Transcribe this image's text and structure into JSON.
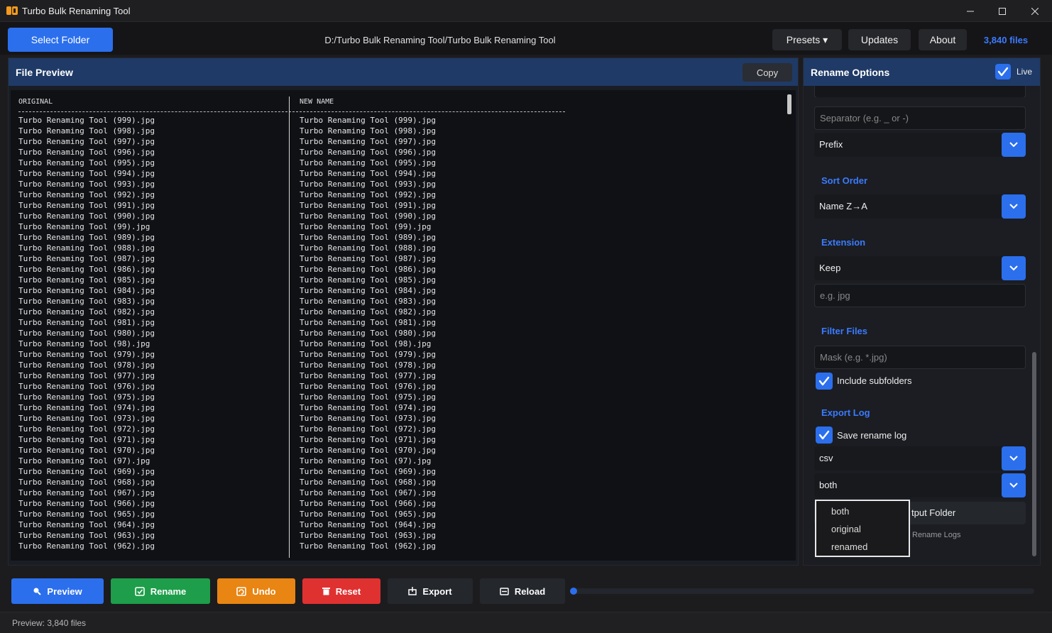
{
  "window": {
    "title": "Turbo Bulk Renaming Tool"
  },
  "toolbar": {
    "select_folder": "Select Folder",
    "path": "D:/Turbo Bulk Renaming Tool/Turbo Bulk Renaming Tool",
    "presets": "Presets ▾",
    "updates": "Updates",
    "about": "About",
    "files_count": "3,840 files"
  },
  "preview": {
    "title": "File Preview",
    "copy": "Copy",
    "col_original": "ORIGINAL",
    "col_new": "NEW NAME",
    "rows": [
      [
        "Turbo Renaming Tool (999).jpg",
        "Turbo Renaming Tool (999).jpg"
      ],
      [
        "Turbo Renaming Tool (998).jpg",
        "Turbo Renaming Tool (998).jpg"
      ],
      [
        "Turbo Renaming Tool (997).jpg",
        "Turbo Renaming Tool (997).jpg"
      ],
      [
        "Turbo Renaming Tool (996).jpg",
        "Turbo Renaming Tool (996).jpg"
      ],
      [
        "Turbo Renaming Tool (995).jpg",
        "Turbo Renaming Tool (995).jpg"
      ],
      [
        "Turbo Renaming Tool (994).jpg",
        "Turbo Renaming Tool (994).jpg"
      ],
      [
        "Turbo Renaming Tool (993).jpg",
        "Turbo Renaming Tool (993).jpg"
      ],
      [
        "Turbo Renaming Tool (992).jpg",
        "Turbo Renaming Tool (992).jpg"
      ],
      [
        "Turbo Renaming Tool (991).jpg",
        "Turbo Renaming Tool (991).jpg"
      ],
      [
        "Turbo Renaming Tool (990).jpg",
        "Turbo Renaming Tool (990).jpg"
      ],
      [
        "Turbo Renaming Tool (99).jpg",
        "Turbo Renaming Tool (99).jpg"
      ],
      [
        "Turbo Renaming Tool (989).jpg",
        "Turbo Renaming Tool (989).jpg"
      ],
      [
        "Turbo Renaming Tool (988).jpg",
        "Turbo Renaming Tool (988).jpg"
      ],
      [
        "Turbo Renaming Tool (987).jpg",
        "Turbo Renaming Tool (987).jpg"
      ],
      [
        "Turbo Renaming Tool (986).jpg",
        "Turbo Renaming Tool (986).jpg"
      ],
      [
        "Turbo Renaming Tool (985).jpg",
        "Turbo Renaming Tool (985).jpg"
      ],
      [
        "Turbo Renaming Tool (984).jpg",
        "Turbo Renaming Tool (984).jpg"
      ],
      [
        "Turbo Renaming Tool (983).jpg",
        "Turbo Renaming Tool (983).jpg"
      ],
      [
        "Turbo Renaming Tool (982).jpg",
        "Turbo Renaming Tool (982).jpg"
      ],
      [
        "Turbo Renaming Tool (981).jpg",
        "Turbo Renaming Tool (981).jpg"
      ],
      [
        "Turbo Renaming Tool (980).jpg",
        "Turbo Renaming Tool (980).jpg"
      ],
      [
        "Turbo Renaming Tool (98).jpg",
        "Turbo Renaming Tool (98).jpg"
      ],
      [
        "Turbo Renaming Tool (979).jpg",
        "Turbo Renaming Tool (979).jpg"
      ],
      [
        "Turbo Renaming Tool (978).jpg",
        "Turbo Renaming Tool (978).jpg"
      ],
      [
        "Turbo Renaming Tool (977).jpg",
        "Turbo Renaming Tool (977).jpg"
      ],
      [
        "Turbo Renaming Tool (976).jpg",
        "Turbo Renaming Tool (976).jpg"
      ],
      [
        "Turbo Renaming Tool (975).jpg",
        "Turbo Renaming Tool (975).jpg"
      ],
      [
        "Turbo Renaming Tool (974).jpg",
        "Turbo Renaming Tool (974).jpg"
      ],
      [
        "Turbo Renaming Tool (973).jpg",
        "Turbo Renaming Tool (973).jpg"
      ],
      [
        "Turbo Renaming Tool (972).jpg",
        "Turbo Renaming Tool (972).jpg"
      ],
      [
        "Turbo Renaming Tool (971).jpg",
        "Turbo Renaming Tool (971).jpg"
      ],
      [
        "Turbo Renaming Tool (970).jpg",
        "Turbo Renaming Tool (970).jpg"
      ],
      [
        "Turbo Renaming Tool (97).jpg",
        "Turbo Renaming Tool (97).jpg"
      ],
      [
        "Turbo Renaming Tool (969).jpg",
        "Turbo Renaming Tool (969).jpg"
      ],
      [
        "Turbo Renaming Tool (968).jpg",
        "Turbo Renaming Tool (968).jpg"
      ],
      [
        "Turbo Renaming Tool (967).jpg",
        "Turbo Renaming Tool (967).jpg"
      ],
      [
        "Turbo Renaming Tool (966).jpg",
        "Turbo Renaming Tool (966).jpg"
      ],
      [
        "Turbo Renaming Tool (965).jpg",
        "Turbo Renaming Tool (965).jpg"
      ],
      [
        "Turbo Renaming Tool (964).jpg",
        "Turbo Renaming Tool (964).jpg"
      ],
      [
        "Turbo Renaming Tool (963).jpg",
        "Turbo Renaming Tool (963).jpg"
      ],
      [
        "Turbo Renaming Tool (962).jpg",
        "Turbo Renaming Tool (962).jpg"
      ]
    ]
  },
  "options": {
    "title": "Rename Options",
    "live": "Live",
    "separator_placeholder": "Separator (e.g. _ or -)",
    "position_value": "Prefix",
    "sort_order_title": "Sort Order",
    "sort_value": "Name Z→A",
    "extension_title": "Extension",
    "extension_value": "Keep",
    "extension_placeholder": "e.g. jpg",
    "filter_title": "Filter Files",
    "mask_placeholder": "Mask (e.g. *.jpg)",
    "include_subfolders": "Include subfolders",
    "export_log_title": "Export Log",
    "save_rename_log": "Save rename log",
    "log_format": "csv",
    "log_names": "both",
    "output_folder_partial": "tput Folder",
    "rename_logs_partial": "Rename Logs"
  },
  "dropdown": {
    "items": [
      "both",
      "original",
      "renamed"
    ]
  },
  "actions": {
    "preview": "Preview",
    "rename": "Rename",
    "undo": "Undo",
    "reset": "Reset",
    "export": "Export",
    "reload": "Reload",
    "progress": 0
  },
  "status": {
    "text": "Preview: 3,840 files"
  },
  "colors": {
    "accent": "#2b6fed",
    "rename": "#1e9e4a",
    "undo": "#e98512",
    "reset": "#e03131",
    "header": "#1f3a66"
  }
}
